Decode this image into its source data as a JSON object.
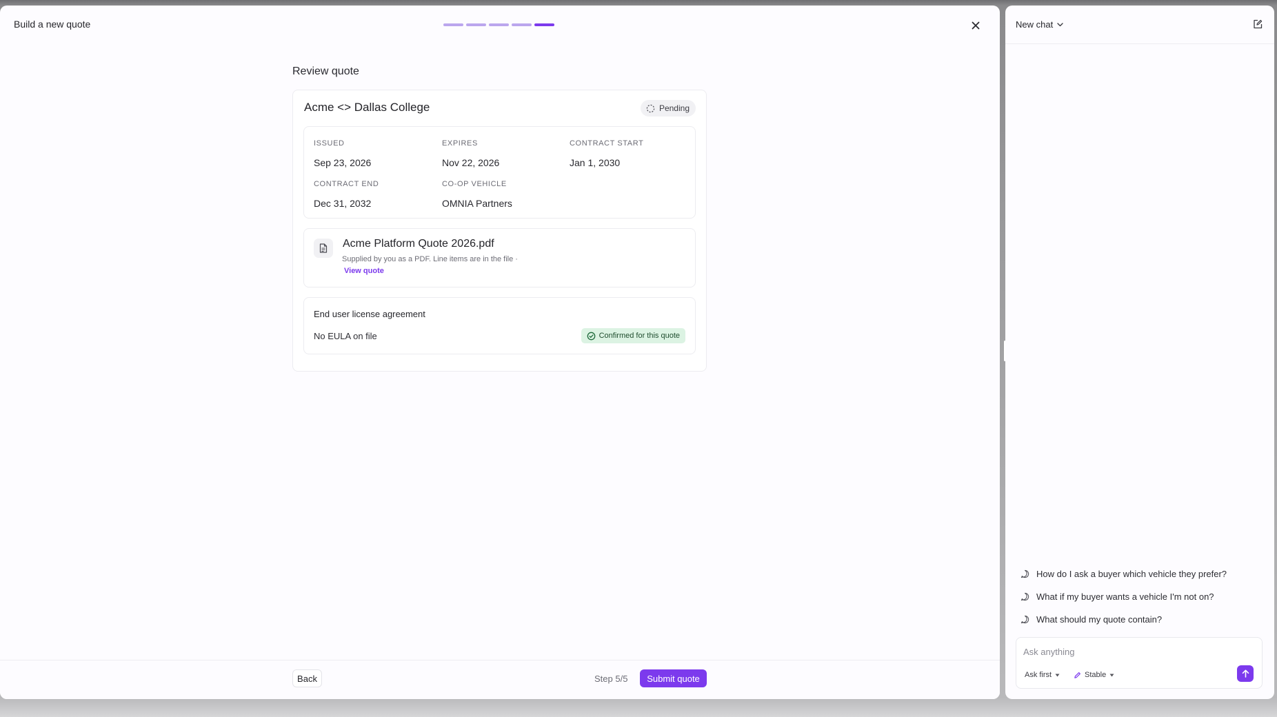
{
  "modal": {
    "title": "Build a new quote",
    "progress": {
      "total_steps": 5,
      "current_step": 5
    },
    "section_title": "Review quote",
    "quote": {
      "title": "Acme <> Dallas College",
      "status": "Pending",
      "fields": [
        {
          "label": "ISSUED",
          "value": "Sep 23, 2026"
        },
        {
          "label": "EXPIRES",
          "value": "Nov 22, 2026"
        },
        {
          "label": "CONTRACT START",
          "value": "Jan 1, 2030"
        },
        {
          "label": "CONTRACT END",
          "value": "Dec 31, 2032"
        },
        {
          "label": "CO-OP VEHICLE",
          "value": "OMNIA Partners"
        }
      ],
      "file": {
        "name": "Acme Platform Quote 2026.pdf",
        "description": "Supplied by you as a PDF. Line items are in the file ·",
        "link_label": "View quote"
      },
      "eula": {
        "title": "End user license agreement",
        "value": "No EULA on file",
        "badge": "Confirmed for this quote"
      }
    },
    "footer": {
      "back_label": "Back",
      "step_text": "Step 5/5",
      "submit_label": "Submit quote"
    }
  },
  "chat": {
    "title": "New chat",
    "suggestions": [
      "How do I ask a buyer which vehicle they prefer?",
      "What if my buyer wants a vehicle I'm not on?",
      "What should my quote contain?"
    ],
    "input_placeholder": "Ask anything",
    "mode_label": "Ask first",
    "model_label": "Stable"
  },
  "colors": {
    "accent": "#7c3aed",
    "accent_light": "#bba6ee",
    "success_bg": "#dcf3e3",
    "success_fg": "#1f4d2e",
    "backdrop": "#8a8a8c"
  },
  "icons": {
    "close": "close-icon",
    "pending": "spinner-icon",
    "file": "document-icon",
    "confirmed": "check-circle-icon",
    "chat_dropdown": "chevron-down-icon",
    "new_chat": "compose-icon",
    "suggestion": "chat-bubble-icon",
    "model": "pencil-icon",
    "send": "arrow-up-icon"
  }
}
